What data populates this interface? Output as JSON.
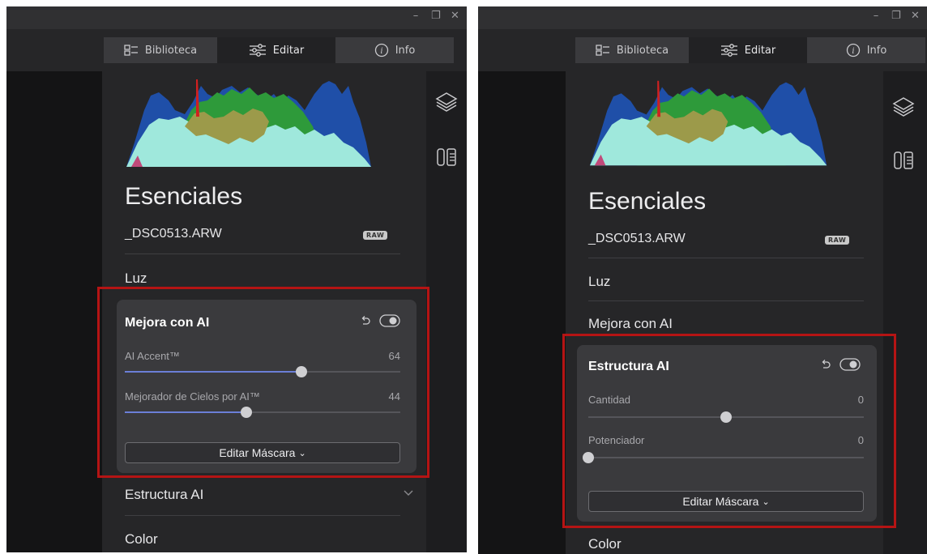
{
  "window_controls": {
    "minimize": "–",
    "restore": "❐",
    "close": "✕"
  },
  "tabs": {
    "library": "Biblioteca",
    "edit": "Editar",
    "info": "Info"
  },
  "left_panel": {
    "section_title": "Esenciales",
    "filename": "_DSC0513.ARW",
    "raw_badge": "RAW",
    "luz": "Luz",
    "card": {
      "title": "Mejora con AI",
      "sliders": [
        {
          "label": "AI Accent™",
          "value": "64",
          "level": 0.64
        },
        {
          "label": "Mejorador de Cielos por AI™",
          "value": "44",
          "level": 0.44
        }
      ],
      "mask_button": "Editar Máscara",
      "mask_chevron": "⌄"
    },
    "estructura": "Estructura AI",
    "color": "Color"
  },
  "right_panel": {
    "section_title": "Esenciales",
    "filename": "_DSC0513.ARW",
    "raw_badge": "RAW",
    "luz": "Luz",
    "mejora": "Mejora con AI",
    "card": {
      "title": "Estructura AI",
      "sliders": [
        {
          "label": "Cantidad",
          "value": "0",
          "level": 0.5
        },
        {
          "label": "Potenciador",
          "value": "0",
          "level": 0.0
        }
      ],
      "mask_button": "Editar Máscara",
      "mask_chevron": "⌄"
    },
    "color": "Color"
  },
  "icons": {
    "layers": "layers-icon",
    "compare": "compare-icon",
    "library": "library-icon",
    "edit": "sliders-icon",
    "info": "info-icon",
    "reset": "undo-icon",
    "visibility": "eye-toggle-icon"
  },
  "colors": {
    "highlight": "#b51414",
    "slider_fill": "#6b7fd8",
    "histogram_blue": "#1f4fa8",
    "histogram_green": "#2e9a3a",
    "histogram_cyan": "#9fe8dc",
    "histogram_olive": "#9c9a4a",
    "histogram_red": "#d02020"
  }
}
